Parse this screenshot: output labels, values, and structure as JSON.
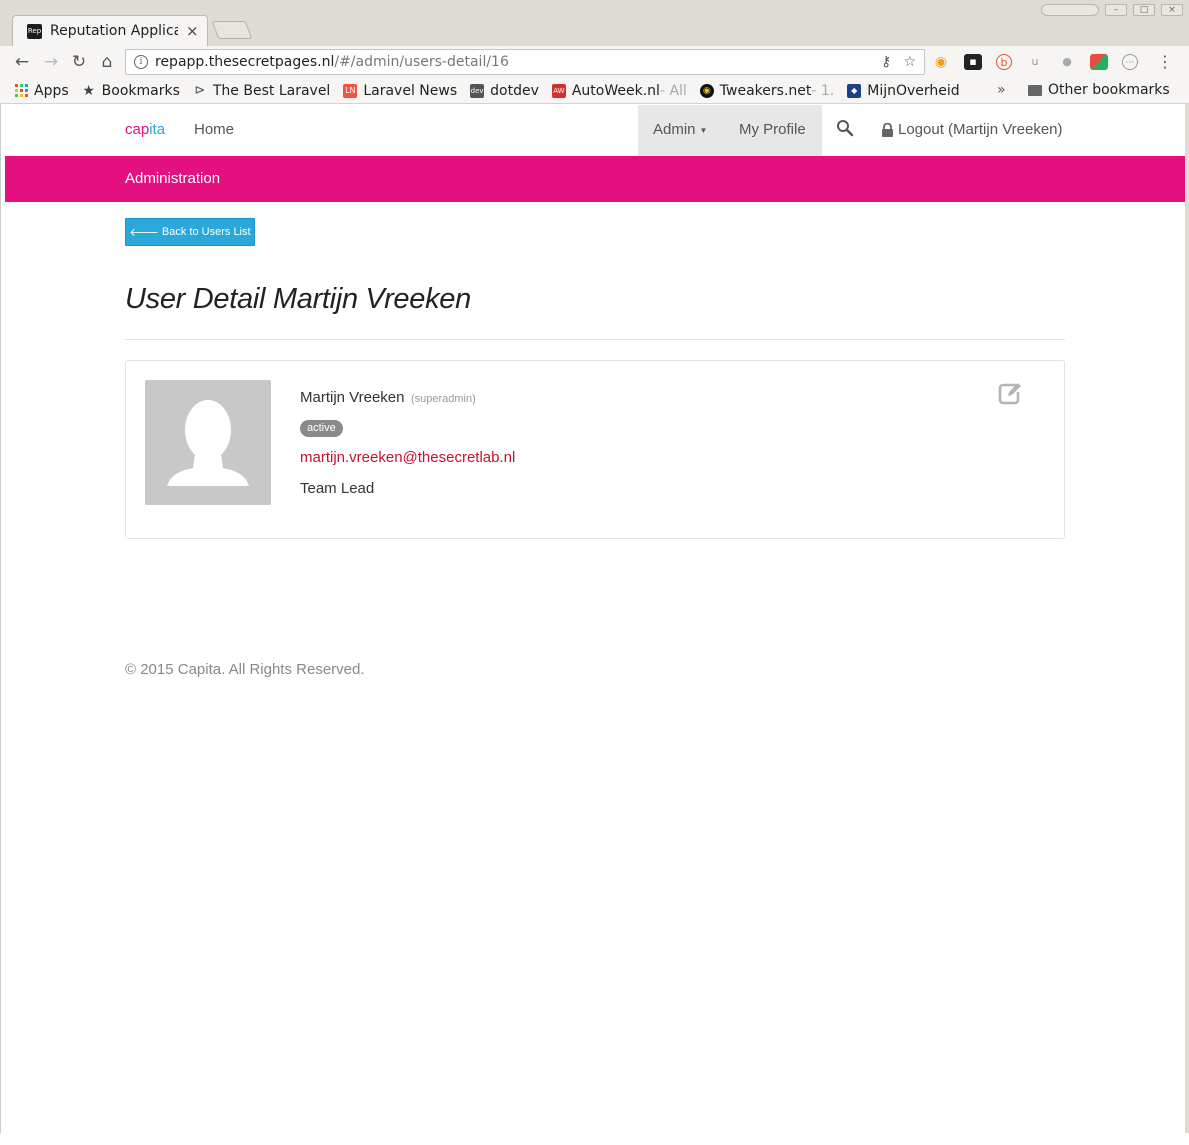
{
  "browser": {
    "tab_title": "Reputation Application",
    "tab_favicon_text": "Rep",
    "url_host": "repapp.thesecretpages.nl",
    "url_path": "/#/admin/users-detail/16",
    "bookmarks": [
      {
        "label": "Apps",
        "icon": "apps-grid-icon"
      },
      {
        "label": "Bookmarks",
        "icon": "star-icon"
      },
      {
        "label": "The Best Laravel",
        "icon": "laravel-icon"
      },
      {
        "label": "Laravel News",
        "icon": "ln-icon"
      },
      {
        "label": "dotdev",
        "icon": "dev-icon"
      },
      {
        "label": "AutoWeek.nl",
        "suffix": " - All",
        "icon": "autoweek-icon"
      },
      {
        "label": "Tweakers.net",
        "suffix": " - 1.",
        "icon": "tweakers-icon"
      },
      {
        "label": "MijnOverheid",
        "icon": "mijnoverheid-icon"
      }
    ],
    "overflow_label": "»",
    "other_bookmarks": "Other bookmarks"
  },
  "navbar": {
    "brand_part1": "cap",
    "brand_part2": "ita",
    "home": "Home",
    "admin": "Admin",
    "my_profile": "My Profile",
    "logout": "Logout (Martijn Vreeken)"
  },
  "admin_bar": {
    "title": "Administration"
  },
  "back_button": "Back to Users List",
  "page_title": "User Detail Martijn Vreeken",
  "user": {
    "name": "Martijn Vreeken",
    "role": "(superadmin)",
    "status": "active",
    "email": "martijn.vreeken@thesecretlab.nl",
    "job_title": "Team Lead"
  },
  "footer": "© 2015 Capita. All Rights Reserved.",
  "colors": {
    "accent_pink": "#e5107f",
    "button_blue": "#2aa8dc",
    "email_red": "#c8102e"
  }
}
